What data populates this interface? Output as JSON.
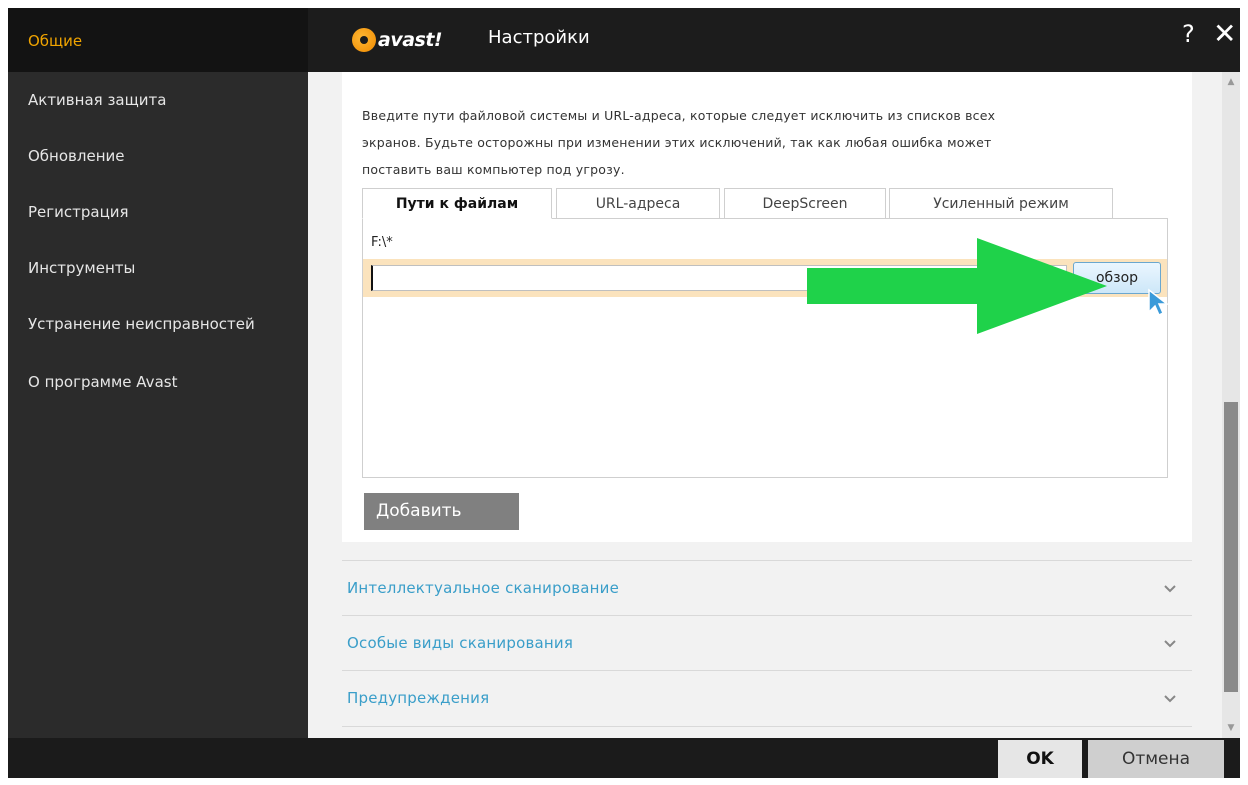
{
  "window": {
    "title": "Настройки",
    "brand": "avast!"
  },
  "header": {
    "help": "?",
    "close": "✕"
  },
  "sidebar": {
    "items": [
      {
        "label": "Общие",
        "active": true
      },
      {
        "label": "Активная защита"
      },
      {
        "label": "Обновление"
      },
      {
        "label": "Регистрация"
      },
      {
        "label": "Инструменты"
      },
      {
        "label": "Устранение неисправностей"
      },
      {
        "label": "О программе Avast"
      }
    ]
  },
  "main": {
    "description_lines": [
      "Введите пути файловой системы и URL-адреса, которые следует исключить из списков всех",
      "экранов. Будьте осторожны при изменении этих исключений, так как любая ошибка может",
      "поставить ваш компьютер под угрозу."
    ],
    "tabs": [
      {
        "label": "Пути к файлам",
        "active": true
      },
      {
        "label": "URL-адреса"
      },
      {
        "label": "DeepScreen"
      },
      {
        "label": "Усиленный режим"
      }
    ],
    "paths": [
      "F:\\*"
    ],
    "path_input_value": "",
    "browse_label": "обзор",
    "add_label": "Добавить",
    "sections": [
      {
        "label": "Интеллектуальное сканирование"
      },
      {
        "label": "Особые виды сканирования"
      },
      {
        "label": "Предупреждения"
      }
    ]
  },
  "footer": {
    "ok_label": "OK",
    "cancel_label": "Отмена"
  },
  "colors": {
    "accent_orange": "#f0a400",
    "section_link": "#3a9ec9",
    "annotation_arrow": "#1fd24a",
    "sidebar_bg": "#2b2b2b"
  }
}
